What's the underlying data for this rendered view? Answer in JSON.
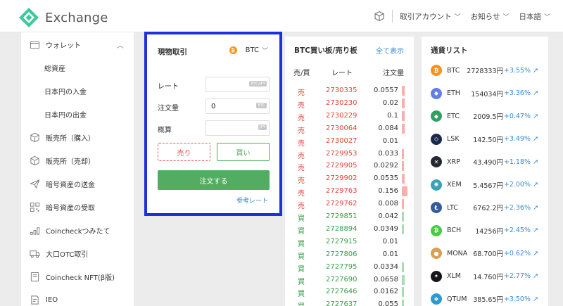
{
  "header": {
    "logo_text": "Exchange",
    "account": "取引アカウント",
    "notice": "お知らせ",
    "language": "日本語"
  },
  "sidebar": {
    "items": [
      {
        "label": "ウォレット",
        "icon": "wallet-icon"
      },
      {
        "label": "総資産"
      },
      {
        "label": "日本円の入金"
      },
      {
        "label": "日本円の出金"
      },
      {
        "label": "販売所（購入）",
        "icon": "box-icon"
      },
      {
        "label": "販売所（売却）",
        "icon": "box-icon"
      },
      {
        "label": "暗号資産の送金",
        "icon": "send-icon"
      },
      {
        "label": "暗号資産の受取",
        "icon": "qr-icon"
      },
      {
        "label": "Coincheckつみたて",
        "icon": "coins-icon"
      },
      {
        "label": "大口OTC取引",
        "icon": "truck-icon"
      },
      {
        "label": "Coincheck NFT(β版)",
        "icon": "nft-icon"
      },
      {
        "label": "IEO",
        "icon": "ieo-icon"
      }
    ]
  },
  "order": {
    "title": "現物取引",
    "coin": "BTC",
    "rate_label": "レート",
    "rate_unit": "BTC/JPY",
    "amount_label": "注文量",
    "amount_value": "0",
    "amount_unit": "BTC",
    "estimate_label": "概算",
    "estimate_unit": "JPY",
    "sell_label": "売り",
    "buy_label": "買い",
    "submit_label": "注文する",
    "ref_rate_label": "参考レート"
  },
  "book": {
    "title": "BTC買い板/売り板",
    "show_all": "全て表示",
    "col_side": "売/買",
    "col_rate": "レート",
    "col_amount": "注文量",
    "rows": [
      {
        "side": "売",
        "rate": "2730335",
        "amount": "0.0557",
        "type": "sell",
        "bar": 0.15
      },
      {
        "side": "売",
        "rate": "2730230",
        "amount": "0.02",
        "type": "sell",
        "bar": 0.15
      },
      {
        "side": "売",
        "rate": "2730229",
        "amount": "0.1",
        "type": "sell",
        "bar": 0.15
      },
      {
        "side": "売",
        "rate": "2730064",
        "amount": "0.084",
        "type": "sell",
        "bar": 0.15
      },
      {
        "side": "売",
        "rate": "2730027",
        "amount": "0.01",
        "type": "sell",
        "bar": 0
      },
      {
        "side": "売",
        "rate": "2729953",
        "amount": "0.033",
        "type": "sell",
        "bar": 0.1
      },
      {
        "side": "売",
        "rate": "2729905",
        "amount": "0.0292",
        "type": "sell",
        "bar": 0.1
      },
      {
        "side": "売",
        "rate": "2729902",
        "amount": "0.0535",
        "type": "sell",
        "bar": 0.15
      },
      {
        "side": "売",
        "rate": "2729763",
        "amount": "0.156",
        "type": "sell",
        "bar": 0.3
      },
      {
        "side": "売",
        "rate": "2729762",
        "amount": "0.008",
        "type": "sell",
        "bar": 0.1
      },
      {
        "side": "買",
        "rate": "2729851",
        "amount": "0.042",
        "type": "buy",
        "bar": 0.1
      },
      {
        "side": "買",
        "rate": "2728894",
        "amount": "0.0349",
        "type": "buy",
        "bar": 0.1
      },
      {
        "side": "買",
        "rate": "2727915",
        "amount": "0.01",
        "type": "buy",
        "bar": 0
      },
      {
        "side": "買",
        "rate": "2727806",
        "amount": "0.01",
        "type": "buy",
        "bar": 0
      },
      {
        "side": "買",
        "rate": "2727795",
        "amount": "0.0334",
        "type": "buy",
        "bar": 0.1
      },
      {
        "side": "買",
        "rate": "2727690",
        "amount": "0.0658",
        "type": "buy",
        "bar": 0.15
      },
      {
        "side": "買",
        "rate": "2727646",
        "amount": "0.0162",
        "type": "buy",
        "bar": 0.1
      },
      {
        "side": "買",
        "rate": "2727637",
        "amount": "0.055",
        "type": "buy",
        "bar": 0.1
      }
    ]
  },
  "currencies": {
    "title": "通貨リスト",
    "items": [
      {
        "symbol": "BTC",
        "price": "2728333円",
        "change": "+3.55%",
        "color": "#f7931a",
        "glyph": "₿"
      },
      {
        "symbol": "ETH",
        "price": "154034円",
        "change": "+3.36%",
        "color": "#627eea",
        "glyph": "◆"
      },
      {
        "symbol": "ETC",
        "price": "2009.5円",
        "change": "+0.47%",
        "color": "#33a063",
        "glyph": "◆"
      },
      {
        "symbol": "LSK",
        "price": "142.50円",
        "change": "+3.49%",
        "color": "#1a2a4a",
        "glyph": "◇"
      },
      {
        "symbol": "XRP",
        "price": "43.490円",
        "change": "+1.18%",
        "color": "#23292f",
        "glyph": "✕"
      },
      {
        "symbol": "XEM",
        "price": "5.4567円",
        "change": "+2.00%",
        "color": "#3aa2b8",
        "glyph": "✺"
      },
      {
        "symbol": "LTC",
        "price": "6762.2円",
        "change": "+2.36%",
        "color": "#345d9d",
        "glyph": "Ł"
      },
      {
        "symbol": "BCH",
        "price": "14256円",
        "change": "+2.45%",
        "color": "#4cc947",
        "glyph": "₿"
      },
      {
        "symbol": "MONA",
        "price": "68.700円",
        "change": "+0.62%",
        "color": "#d9a055",
        "glyph": "●"
      },
      {
        "symbol": "XLM",
        "price": "14.760円",
        "change": "+2.77%",
        "color": "#14161a",
        "glyph": "✦"
      },
      {
        "symbol": "QTUM",
        "price": "385.65円",
        "change": "+3.50%",
        "color": "#2e9ad0",
        "glyph": "❖"
      }
    ]
  }
}
